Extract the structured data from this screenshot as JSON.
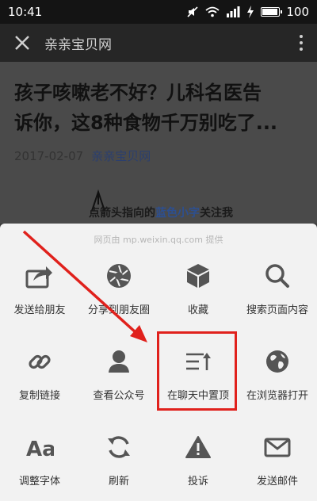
{
  "status_bar": {
    "time": "10:41",
    "battery_level": "100",
    "icons": [
      "mute-icon",
      "wifi-icon",
      "signal-icon",
      "charging-icon",
      "battery-icon"
    ]
  },
  "title_bar": {
    "close_icon": "close-icon",
    "title": "亲亲宝贝网",
    "menu_icon": "more-vertical-icon"
  },
  "article": {
    "headline_line1": "孩子咳嗽老不好？儿科名医告",
    "headline_line2": "诉你，这8种食物千万别吃了...",
    "date": "2017-02-07",
    "source": "亲亲宝贝网",
    "hint_prefix": "点箭头指向的",
    "hint_blue": "蓝色小字",
    "hint_suffix": "关注我"
  },
  "sheet": {
    "provider": "网页由 mp.weixin.qq.com 提供",
    "rows": [
      [
        {
          "label": "发送给朋友",
          "icon": "share-icon"
        },
        {
          "label": "分享到朋友圈",
          "icon": "moments-icon"
        },
        {
          "label": "收藏",
          "icon": "favorite-cube-icon"
        },
        {
          "label": "搜索页面内容",
          "icon": "search-icon"
        }
      ],
      [
        {
          "label": "复制链接",
          "icon": "link-icon"
        },
        {
          "label": "查看公众号",
          "icon": "official-account-icon"
        },
        {
          "label": "在聊天中置顶",
          "icon": "pin-to-top-icon"
        },
        {
          "label": "在浏览器打开",
          "icon": "globe-icon"
        }
      ],
      [
        {
          "label": "调整字体",
          "icon": "font-size-icon"
        },
        {
          "label": "刷新",
          "icon": "refresh-icon"
        },
        {
          "label": "投诉",
          "icon": "warning-icon"
        },
        {
          "label": "发送邮件",
          "icon": "mail-icon"
        }
      ]
    ]
  },
  "annotations": {
    "highlight_color": "#e0211c",
    "arrow_color": "#e0211c"
  }
}
